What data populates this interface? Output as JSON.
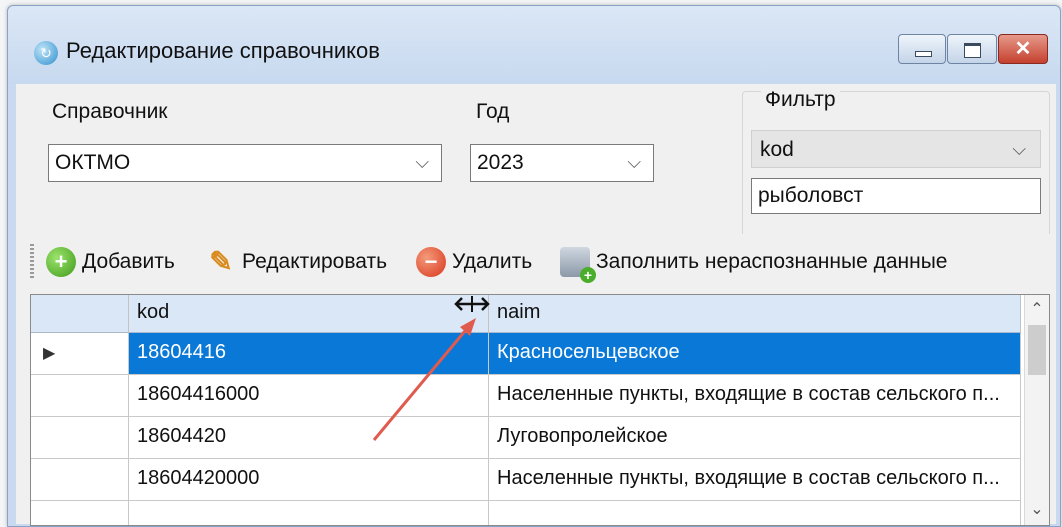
{
  "window": {
    "title": "Редактирование справочников"
  },
  "form": {
    "reference_label": "Справочник",
    "reference_value": "ОКТМО",
    "year_label": "Год",
    "year_value": "2023",
    "filter": {
      "title": "Фильтр",
      "field_value": "kod",
      "search_value": "рыболовст"
    }
  },
  "toolbar": {
    "add_label": "Добавить",
    "edit_label": "Редактировать",
    "delete_label": "Удалить",
    "fill_label": "Заполнить нераспознанные данные"
  },
  "grid": {
    "columns": [
      "kod",
      "naim"
    ],
    "rows": [
      {
        "kod": "18604416",
        "naim": "Красносельцевское",
        "selected": true
      },
      {
        "kod": "18604416000",
        "naim": "Населенные пункты, входящие в состав сельского п..."
      },
      {
        "kod": "18604420",
        "naim": "Луговопролейское"
      },
      {
        "kod": "18604420000",
        "naim": "Населенные пункты, входящие в состав сельского п..."
      }
    ]
  },
  "colors": {
    "selection": "#0a78d7",
    "annotation_arrow": "#e05a4e"
  },
  "icons": {
    "add": "plus-circle-icon",
    "edit": "pencil-icon",
    "delete": "minus-circle-icon",
    "fill": "database-add-icon",
    "cursor": "column-resize-cursor-icon"
  }
}
